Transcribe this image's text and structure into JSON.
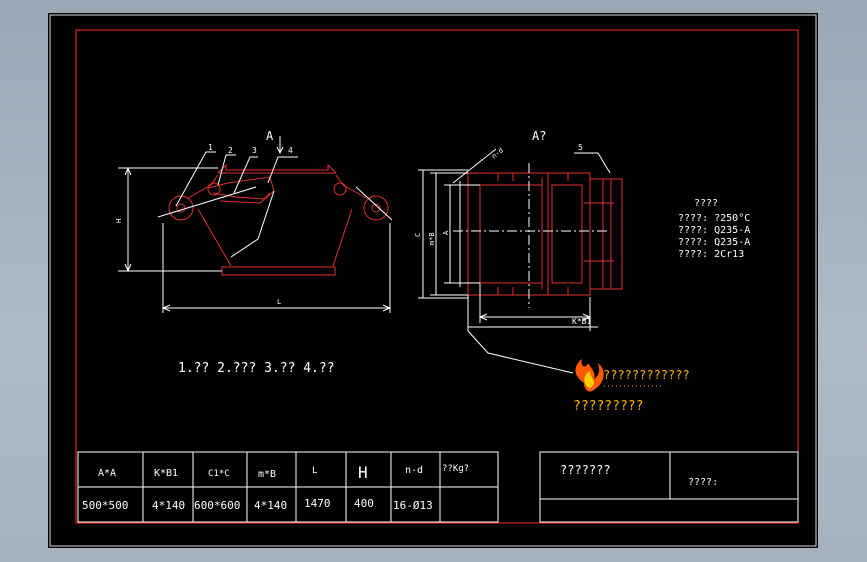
{
  "colors": {
    "frame": "#ff2a2a",
    "part": "#e03030",
    "line": "#ffffff",
    "text": "#ffffff",
    "logo_text": "#ffb000",
    "background": "#000000",
    "window": "#a6b2bf"
  },
  "front_view": {
    "labels": [
      "1",
      "2",
      "3",
      "4"
    ],
    "view_arrow": "A",
    "dim_height": "H",
    "dim_length": "L"
  },
  "side_view": {
    "title": "A?",
    "callout_5": "5",
    "callout_nd": "n-d",
    "dim_c": "C",
    "dim_mb": "m*B",
    "dim_a": "A",
    "dim_kb": "K*B1"
  },
  "notes": {
    "title": "????",
    "lines": [
      "????: ?250°C",
      "????: Q235-A",
      "????: Q235-A",
      "????: 2Cr13"
    ]
  },
  "parts_caption": "1.?? 2.??? 3.?? 4.??",
  "watermark": {
    "line1": "????????????",
    "line2": "?????????",
    "logo_icon": "flame-logo"
  },
  "table": {
    "headers": [
      "A*A",
      "K*B1",
      "C1*C",
      "m*B",
      "L",
      "H",
      "n-d",
      "??Kg?"
    ],
    "row": [
      "500*500",
      "4*140",
      "600*600",
      "4*140",
      "1470",
      "400",
      "16-Ø13",
      ""
    ]
  },
  "title_block": {
    "name": "???????",
    "field": "????:"
  }
}
